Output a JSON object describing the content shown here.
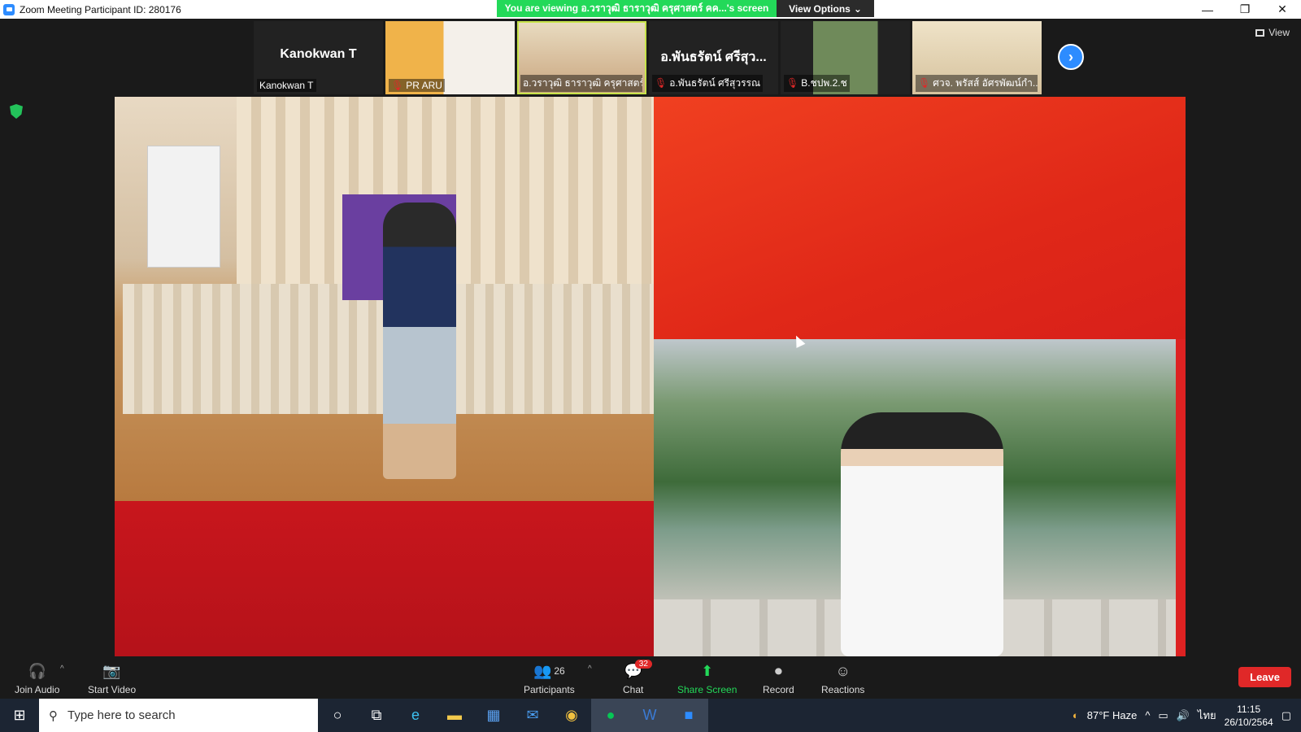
{
  "window": {
    "title": "Zoom Meeting Participant ID: 280176",
    "banner": "You are viewing อ.วราวุฒิ ธาราวุฒิ ครุศาสตร์ คค...'s screen",
    "view_options": "View Options"
  },
  "participants_strip": [
    {
      "big_name": "Kanokwan T",
      "label": "Kanokwan T",
      "muted": false
    },
    {
      "big_name": "",
      "label": "PR ARU",
      "muted": true
    },
    {
      "big_name": "",
      "label": "อ.วราวุฒิ ธาราวุฒิ ครุศาสตร์ ...",
      "muted": false,
      "active": true
    },
    {
      "big_name": "อ.พันธรัตน์ ศรีสุว...",
      "label": "อ.พันธรัตน์ ศรีสุวรรณ",
      "muted": true
    },
    {
      "big_name": "",
      "label": "B.ชปพ.2.ช",
      "muted": true
    },
    {
      "big_name": "",
      "label": "ศวจ. พรัสส์ อัศรพัฒน์กำ...",
      "muted": true
    }
  ],
  "view_label": "View",
  "toolbar": {
    "join_audio": "Join Audio",
    "start_video": "Start Video",
    "participants": "Participants",
    "participants_count": "26",
    "chat": "Chat",
    "chat_badge": "32",
    "share_screen": "Share Screen",
    "record": "Record",
    "reactions": "Reactions",
    "leave": "Leave"
  },
  "taskbar": {
    "search_placeholder": "Type here to search",
    "weather": "87°F  Haze",
    "lang": "ไทย",
    "time": "11:15",
    "date": "26/10/2564"
  },
  "colors": {
    "accent": "#2d8cff",
    "banner": "#23d959",
    "leave": "#e02828"
  }
}
